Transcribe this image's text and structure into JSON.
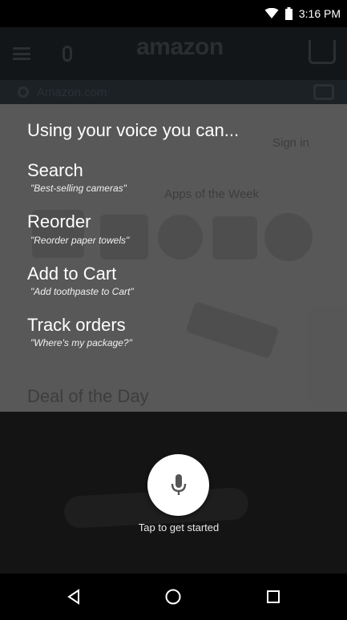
{
  "status_bar": {
    "time": "3:16 PM"
  },
  "background_app": {
    "logo": "amazon",
    "search_placeholder": "Amazon.com"
  },
  "voice_panel": {
    "heading": "Using your voice you can...",
    "items": [
      {
        "command": "Search",
        "example": "\"Best-selling cameras\""
      },
      {
        "command": "Reorder",
        "example": "\"Reorder paper towels\""
      },
      {
        "command": "Add to Cart",
        "example": "\"Add toothpaste to Cart\""
      },
      {
        "command": "Track orders",
        "example": "\"Where's my package?\""
      }
    ],
    "ghost_texts": [
      "Sign in",
      "Apps of the Week",
      "Deal of the Day"
    ]
  },
  "mic": {
    "caption": "Tap to get started"
  },
  "nav": {
    "back": "back-icon",
    "home": "home-icon",
    "recents": "recents-icon"
  }
}
